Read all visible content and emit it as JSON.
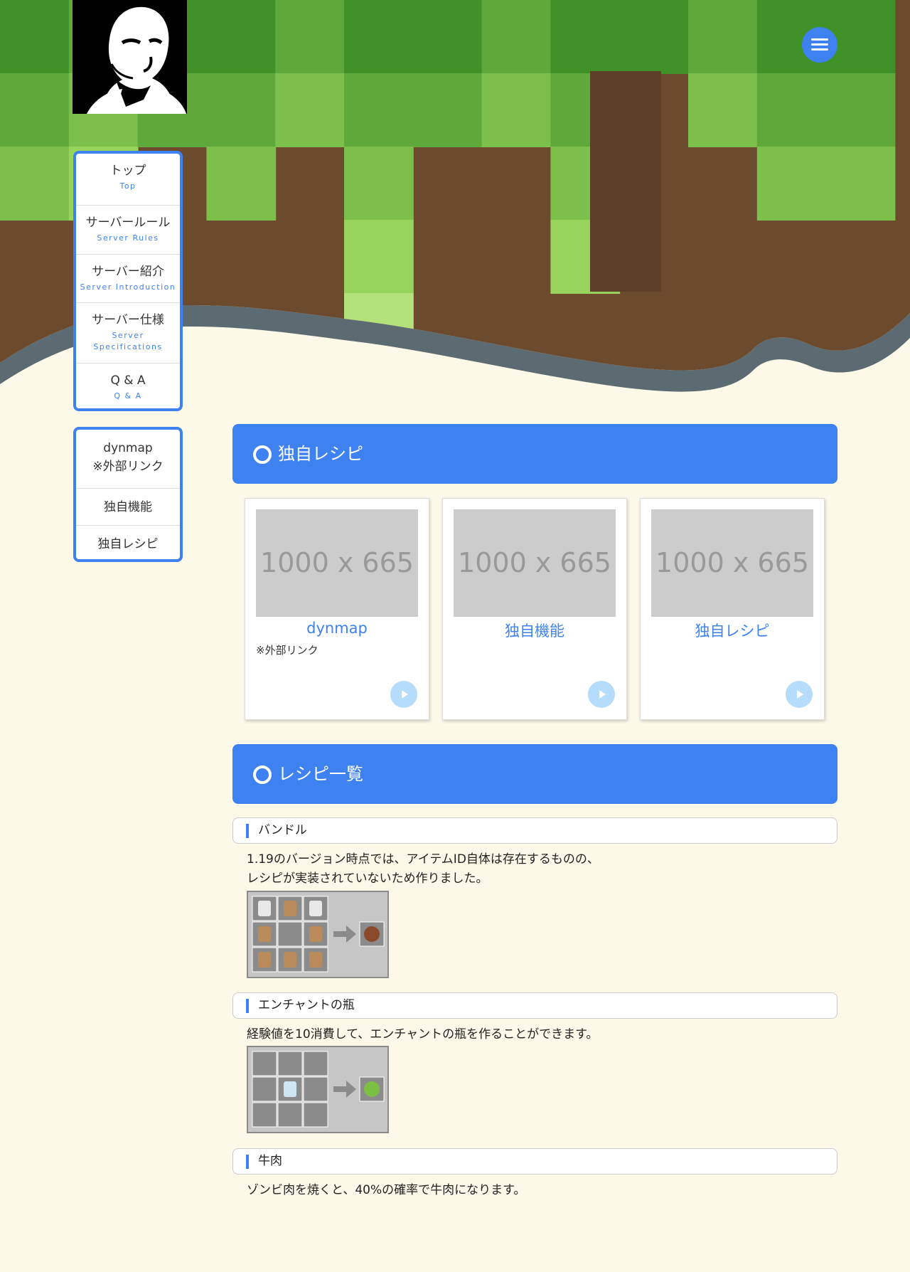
{
  "header": {
    "logo_name": "portrait-logo",
    "menu_icon": "hamburger-menu-icon"
  },
  "nav_main": [
    {
      "jp": "トップ",
      "en": "Top"
    },
    {
      "jp": "サーバールール",
      "en": "Server Rules"
    },
    {
      "jp": "サーバー紹介",
      "en": "Server Introduction"
    },
    {
      "jp": "サーバー仕様",
      "en": "Server Specifications"
    },
    {
      "jp": "Q & A",
      "en": "Q & A"
    }
  ],
  "nav_sub": [
    {
      "line1": "dynmap",
      "line2": "※外部リンク"
    },
    {
      "line1": "独自機能",
      "line2": ""
    },
    {
      "line1": "独自レシピ",
      "line2": ""
    }
  ],
  "sections": {
    "recipes_header": "独自レシピ",
    "list_header": "レシピ一覧"
  },
  "cards": [
    {
      "placeholder": "1000 x 665",
      "title": "dynmap",
      "sub": "※外部リンク"
    },
    {
      "placeholder": "1000 x 665",
      "title": "独自機能",
      "sub": ""
    },
    {
      "placeholder": "1000 x 665",
      "title": "独自レシピ",
      "sub": ""
    }
  ],
  "recipes": [
    {
      "title": "バンドル",
      "desc_line1": "1.19のバージョン時点では、アイテムID自体は存在するものの、",
      "desc_line2": "レシピが実装されていないため作りました。",
      "grid_icons": [
        "string-icon",
        "rabbit-hide-icon",
        "string-icon",
        "rabbit-hide-icon",
        "",
        "rabbit-hide-icon",
        "rabbit-hide-icon",
        "rabbit-hide-icon",
        "rabbit-hide-icon"
      ],
      "result_icon": "bundle-icon"
    },
    {
      "title": "エンチャントの瓶",
      "desc_line1": "経験値を10消費して、エンチャントの瓶を作ることができます。",
      "desc_line2": "",
      "grid_icons": [
        "",
        "",
        "",
        "",
        "glass-bottle-icon",
        "",
        "",
        "",
        ""
      ],
      "result_icon": "enchanting-bottle-icon"
    },
    {
      "title": "牛肉",
      "desc_line1": "ゾンビ肉を焼くと、40%の確率で牛肉になります。",
      "desc_line2": ""
    }
  ],
  "colors": {
    "accent": "#3d82f0",
    "page_bg": "#fdf9e8",
    "grass_light": "#8fd14f",
    "grass_dark": "#3f9128",
    "dirt": "#6b4a2e"
  }
}
